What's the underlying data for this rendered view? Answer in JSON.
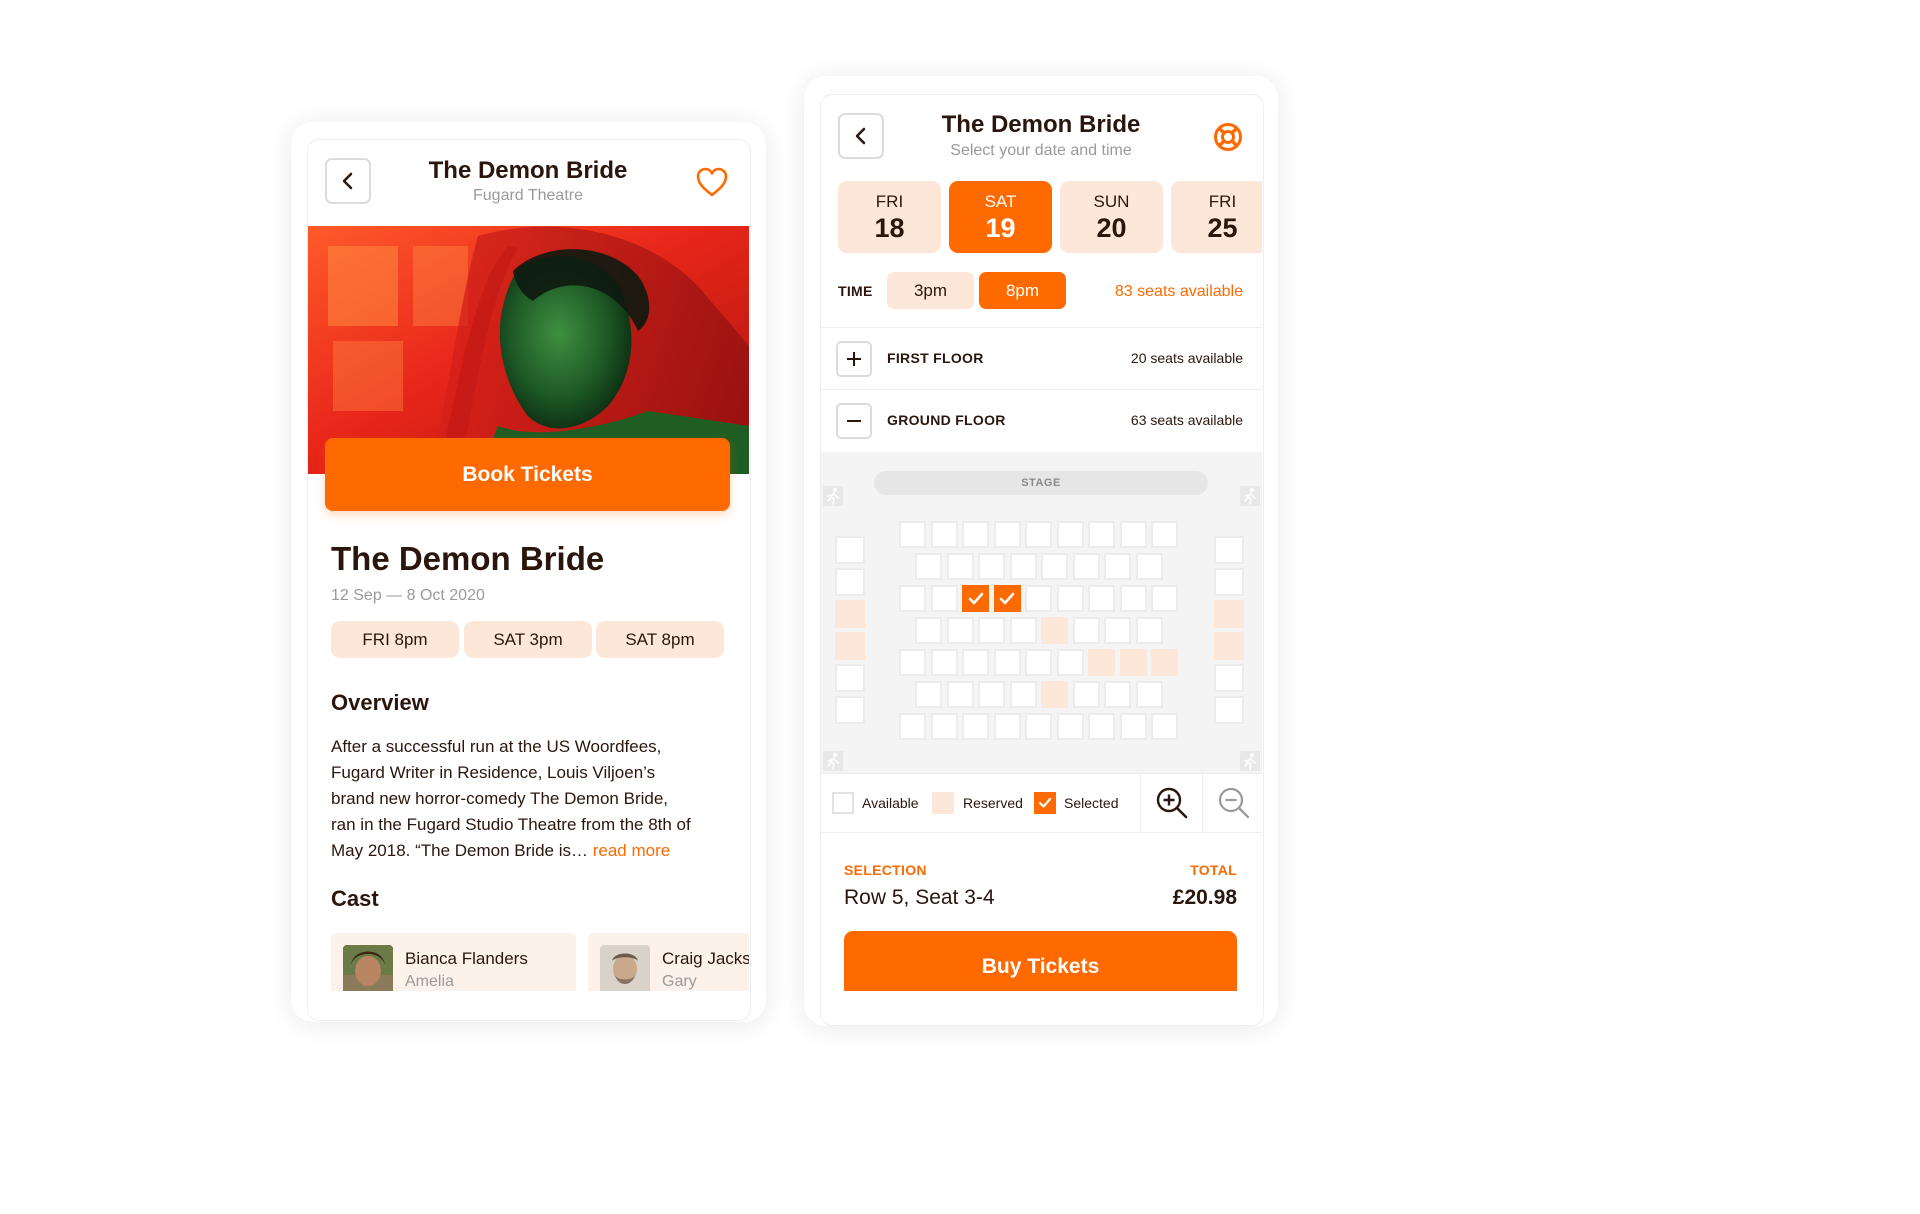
{
  "detail": {
    "header_title": "The Demon Bride",
    "header_subtitle": "Fugard Theatre",
    "book_button": "Book Tickets",
    "show_title": "The Demon Bride",
    "date_range": "12 Sep — 8 Oct 2020",
    "showtimes": [
      "FRI 8pm",
      "SAT 3pm",
      "SAT 8pm"
    ],
    "overview_heading": "Overview",
    "overview_lines": [
      "After a successful run at the US Woordfees,",
      "Fugard Writer in Residence, Louis Viljoen’s",
      "brand new horror-comedy The Demon Bride,",
      "ran in the Fugard Studio Theatre from the 8th of",
      "May 2018. “The Demon Bride is… "
    ],
    "read_more": "read more",
    "cast_heading": "Cast",
    "cast": [
      {
        "name": "Bianca Flanders",
        "role": "Amelia"
      },
      {
        "name": "Craig Jackson",
        "role": "Gary"
      }
    ]
  },
  "booking": {
    "header_title": "The Demon Bride",
    "header_subtitle": "Select your date and time",
    "dates": [
      {
        "dow": "FRI",
        "day": "18",
        "selected": false
      },
      {
        "dow": "SAT",
        "day": "19",
        "selected": true
      },
      {
        "dow": "SUN",
        "day": "20",
        "selected": false
      },
      {
        "dow": "FRI",
        "day": "25",
        "selected": false
      }
    ],
    "time_label": "TIME",
    "times": [
      {
        "label": "3pm",
        "selected": false
      },
      {
        "label": "8pm",
        "selected": true
      }
    ],
    "seats_available": "83 seats available",
    "floors": [
      {
        "label": "FIRST FLOOR",
        "seats": "20 seats available",
        "expanded": false
      },
      {
        "label": "GROUND FLOOR",
        "seats": "63 seats available",
        "expanded": true
      }
    ],
    "stage_label": "STAGE",
    "legend": {
      "available": "Available",
      "reserved": "Reserved",
      "selected": "Selected"
    },
    "selection_label": "SELECTION",
    "selection_value": "Row 5, Seat 3-4",
    "total_label": "TOTAL",
    "total_value": "£20.98",
    "buy_button": "Buy Tickets"
  },
  "seat_map": {
    "rows": [
      {
        "count": 9,
        "offset": false,
        "reserved": [],
        "selected": []
      },
      {
        "count": 8,
        "offset": true,
        "reserved": [],
        "selected": []
      },
      {
        "count": 9,
        "offset": false,
        "reserved": [],
        "selected": [
          2,
          3
        ]
      },
      {
        "count": 8,
        "offset": true,
        "reserved": [
          4
        ],
        "selected": []
      },
      {
        "count": 9,
        "offset": false,
        "reserved": [
          6,
          7,
          8
        ],
        "selected": []
      },
      {
        "count": 8,
        "offset": true,
        "reserved": [
          4
        ],
        "selected": []
      },
      {
        "count": 9,
        "offset": false,
        "reserved": [],
        "selected": []
      }
    ],
    "side_reserved": [
      2,
      3
    ]
  },
  "colors": {
    "accent": "#ff6a00",
    "accent_light": "#fde7d8",
    "text": "#2a160c",
    "muted": "#9a9a9a"
  }
}
